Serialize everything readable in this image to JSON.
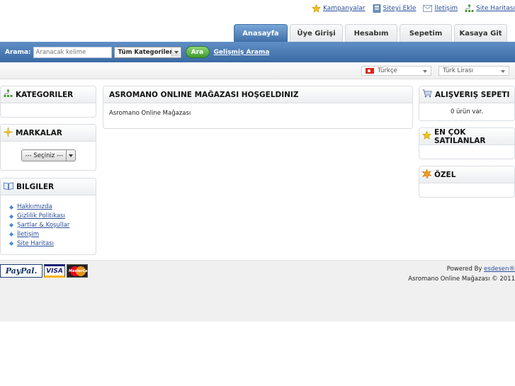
{
  "top_links": [
    {
      "label": "Kampanyalar",
      "icon": "star-icon"
    },
    {
      "label": "Siteyi Ekle",
      "icon": "bookmark-icon"
    },
    {
      "label": "İletişim",
      "icon": "mail-icon"
    },
    {
      "label": "Site Haritası",
      "icon": "sitemap-icon"
    }
  ],
  "tabs": [
    {
      "label": "Anasayfa",
      "active": true
    },
    {
      "label": "Üye Girişi",
      "active": false
    },
    {
      "label": "Hesabım",
      "active": false
    },
    {
      "label": "Sepetim",
      "active": false
    },
    {
      "label": "Kasaya Git",
      "active": false
    }
  ],
  "search": {
    "label": "Arama:",
    "placeholder": "Aranacak kelime",
    "category": "Tüm Kategoriler",
    "button": "Ara",
    "advanced": "Gelişmiş Arama"
  },
  "language": "Türkçe",
  "currency": "Türk Lirası",
  "left": {
    "categories_title": "KATEGORILER",
    "brands_title": "MARKALAR",
    "brands_select": "--- Seçiniz ---",
    "info_title": "BILGILER",
    "info_links": [
      "Hakkımızda",
      "Gizlilik Politikası",
      "Şartlar & Koşullar",
      "İletişim",
      "Site Haritası"
    ]
  },
  "main": {
    "title": "ASROMANO ONLINE MAĞAZASI HOŞGELDINIZ",
    "text": "Asromano Online Mağazası"
  },
  "right": {
    "cart_title": "ALIŞVERIŞ SEPETI",
    "cart_text": "0 ürün var.",
    "bestsellers_title": "EN ÇOK SATILANLAR",
    "special_title": "ÖZEL"
  },
  "footer": {
    "powered_prefix": "Powered By ",
    "powered_link": "esdesen®",
    "copyright": "Asromano Online Mağazası © 2011",
    "payment_logos": [
      "PayPal",
      "VISA",
      "MasterCard"
    ]
  },
  "colors": {
    "accent": "#3b6aa3",
    "link": "#2a4f9a",
    "search_button": "#3f9a2f"
  }
}
